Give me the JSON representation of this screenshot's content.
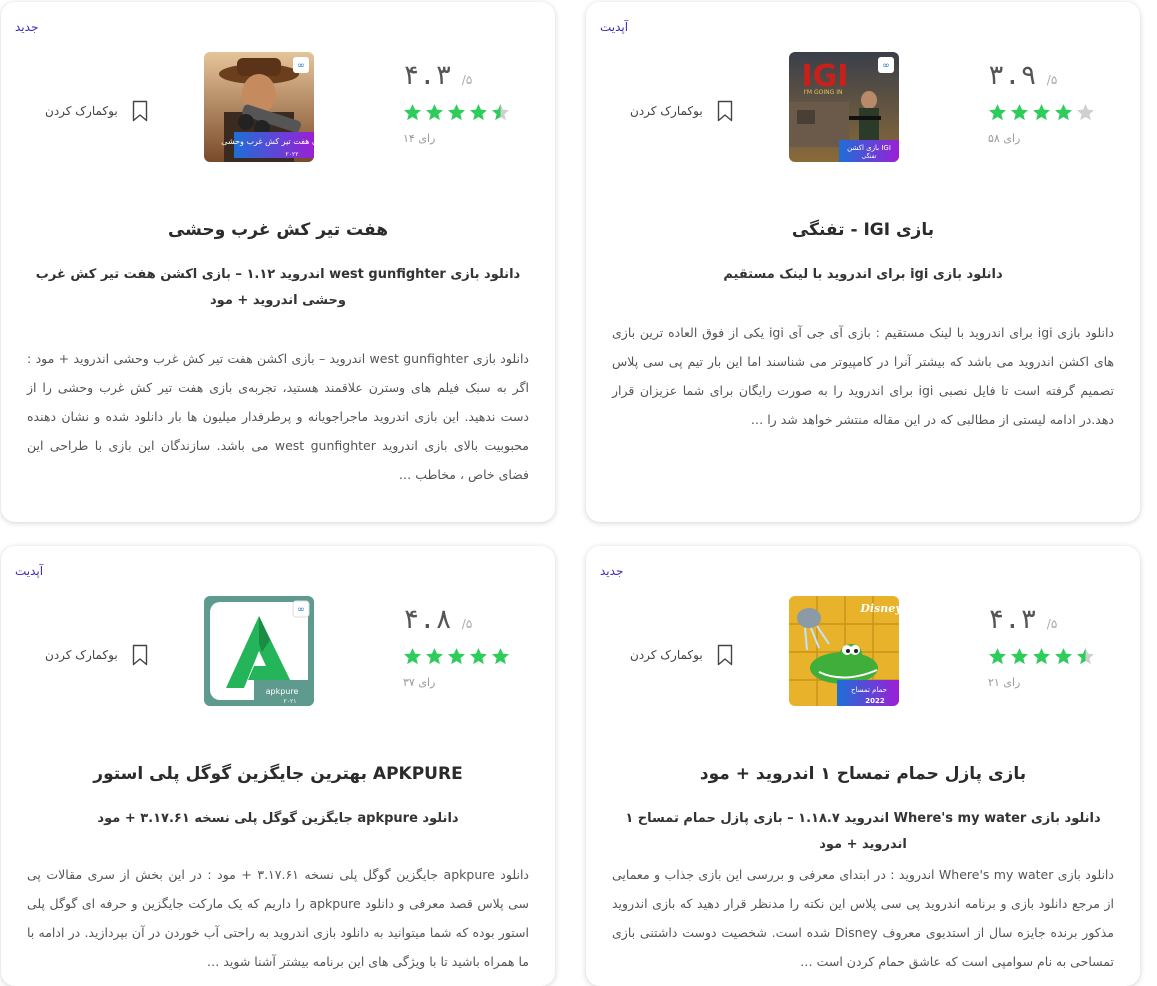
{
  "cards": [
    {
      "badge": "جدید",
      "score": "۴.۳",
      "out_of": "/۵",
      "stars": 4.5,
      "votes": "۱۴ رای",
      "bookmark_label": "بوکمارک کردن",
      "title": "هفت تیر کش غرب وحشی",
      "subtitle": "دانلود بازی west gunfighter اندروید ۱.۱۲ – بازی اکشن هفت تیر کش غرب وحشی اندروید + مود",
      "excerpt": "دانلود بازی west gunfighter اندروید – بازی اکشن هفت تیر کش غرب وحشی اندروید + مود : اگر به سبک فیلم های وسترن علاقمند هستید، تجربه‌ی بازی هفت تیر کش غرب وحشی را از دست ندهید. این بازی اندروید ماجراجویانه و پرطرفدار میلیون ها بار دانلود شده و نشان دهنده محبوبیت بالای بازی اندروید west gunfighter می باشد. سازندگان این بازی با طراحی این فضای خاص ، مخاطب …",
      "icon_text": "بازی هفت تیر کش غرب وحشی",
      "icon_year": "۲۰۲۲"
    },
    {
      "badge": "آپدیت",
      "score": "۳.۹",
      "out_of": "/۵",
      "stars": 4,
      "votes": "۵۸ رای",
      "bookmark_label": "بوکمارک کردن",
      "title": "بازی IGI - تفنگی",
      "subtitle": "دانلود بازی igi برای اندروید با لینک مستقیم",
      "excerpt": "دانلود بازی igi برای اندروید با لینک مستقیم : بازی آی جی آی igi یکی از فوق العاده ترین بازی های اکشن اندروید می باشد که بیشتر آنرا در کامپیوتر می شناسند اما این بار تیم پی سی پلاس تصمیم گرفته است تا فایل نصبی igi برای اندروید را به صورت رایگان برای شما عزیزان قرار دهد.در ادامه لیستی از مطالبی که در این مقاله منتشر خواهد شد را …",
      "icon_text": "IGI",
      "icon_sub": "I'M GOING IN",
      "icon_caption": "بازی اکشن IGI",
      "icon_caption2": "تفنگی"
    },
    {
      "badge": "آپدیت",
      "score": "۴.۸",
      "out_of": "/۵",
      "stars": 5,
      "votes": "۳۷ رای",
      "bookmark_label": "بوکمارک کردن",
      "title": "APKPURE بهترین جایگزین گوگل پلی استور",
      "subtitle": "دانلود apkpure جایگزین گوگل پلی نسخه ۳.۱۷.۶۱ + مود",
      "excerpt": "دانلود apkpure جایگزین گوگل پلی نسخه ۳.۱۷.۶۱ + مود : در این بخش از سری مقالات پی سی پلاس قصد معرفی و دانلود apkpure را داریم که یک مارکت جایگزین و حرفه ای گوگل پلی استور بوده که شما میتوانید به دانلود بازی اندروید به راحتی آب خوردن در آن بپردازید. در ادامه با ما همراه باشید تا با ویژگی های این برنامه بیشتر آشنا شوید …",
      "icon_text": "apkpure",
      "icon_year": "۲۰۲۱"
    },
    {
      "badge": "جدید",
      "score": "۴.۳",
      "out_of": "/۵",
      "stars": 4.5,
      "votes": "۲۱ رای",
      "bookmark_label": "بوکمارک کردن",
      "title": "بازی پازل حمام تمساح ۱ اندروید + مود",
      "subtitle": "دانلود بازی Where's my water اندروید ۱.۱۸.۷ – بازی پازل حمام تمساح ۱ اندروید + مود",
      "excerpt": "دانلود بازی Where's my water اندروید : در ابتدای معرفی و بررسی این بازی جذاب و معمایی از مرجع دانلود بازی و برنامه اندروید پی سی پلاس این نکته را مدنظر قرار دهید که بازی اندروید مذکور برنده جایزه سال از استدیوی معروف Disney شده است. شخصیت دوست داشتنی بازی تمساحی به نام سوامپی است که عاشق حمام کردن است …",
      "icon_text": "حمام تمساح",
      "icon_year": "2022",
      "icon_brand": "Disney"
    }
  ],
  "colors": {
    "star_on": "#2ecc5a",
    "star_off": "#cfcfcf",
    "badge": "#3b2db8"
  }
}
